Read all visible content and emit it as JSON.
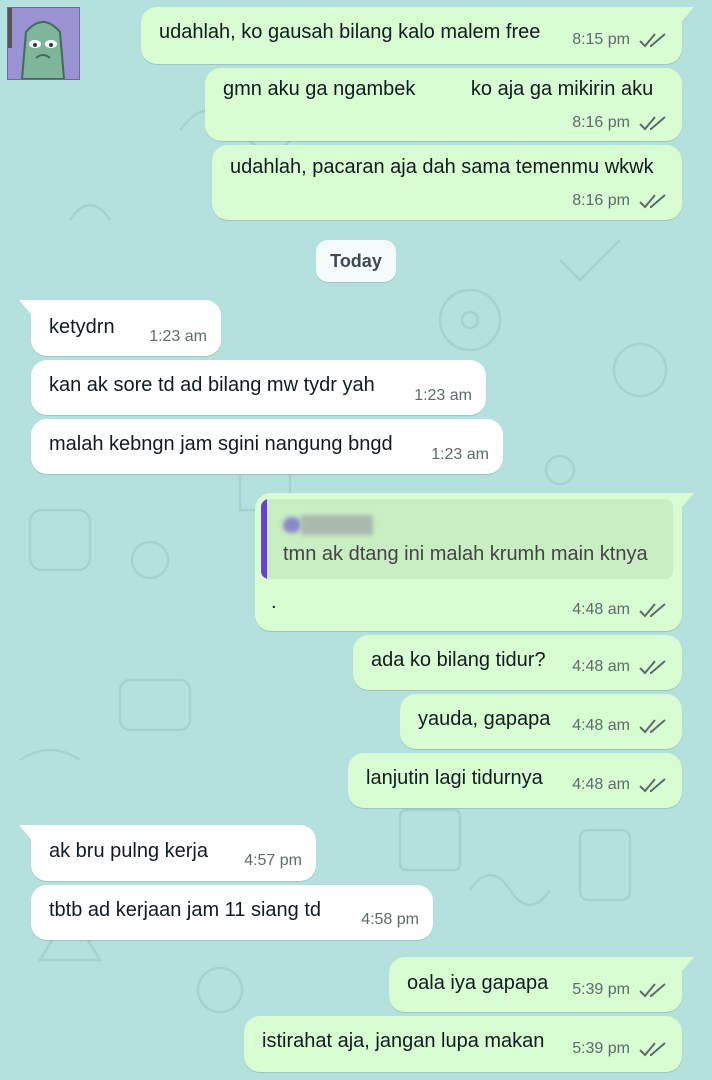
{
  "chat": {
    "date_separator": "Today",
    "messages": [
      {
        "dir": "out",
        "text": "udahlah, ko gausah bilang kalo malem free",
        "time": "8:15 pm",
        "status": "read"
      },
      {
        "dir": "out",
        "text": "gmn aku ga ngambek          ko aja ga mikirin aku",
        "time": "8:16 pm",
        "status": "read"
      },
      {
        "dir": "out",
        "text": "udahlah, pacaran aja dah sama temenmu wkwk",
        "time": "8:16 pm",
        "status": "read"
      },
      {
        "dir": "in",
        "text": "ketydrn",
        "time": "1:23 am"
      },
      {
        "dir": "in",
        "text": "kan ak sore td ad bilang mw tydr yah",
        "time": "1:23 am"
      },
      {
        "dir": "in",
        "text": "malah kebngn jam sgini nangung bngd",
        "time": "1:23 am"
      },
      {
        "dir": "out",
        "quoted_text": "tmn ak dtang ini malah krumh main ktnya",
        "text": ".",
        "time": "4:48 am",
        "status": "read"
      },
      {
        "dir": "out",
        "text": "ada ko bilang tidur?",
        "time": "4:48 am",
        "status": "read"
      },
      {
        "dir": "out",
        "text": "yauda, gapapa",
        "time": "4:48 am",
        "status": "read"
      },
      {
        "dir": "out",
        "text": "lanjutin lagi tidurnya",
        "time": "4:48 am",
        "status": "read"
      },
      {
        "dir": "in",
        "text": "ak bru pulng kerja",
        "time": "4:57 pm"
      },
      {
        "dir": "in",
        "text": "tbtb ad kerjaan jam 11 siang td",
        "time": "4:58 pm"
      },
      {
        "dir": "out",
        "text": "oala iya gapapa",
        "time": "5:39 pm",
        "status": "read"
      },
      {
        "dir": "out",
        "text": "istirahat aja, jangan lupa makan",
        "time": "5:39 pm",
        "status": "read"
      }
    ]
  },
  "colors": {
    "wallpaper": "#b4e1de",
    "outgoing_bubble": "#d8fdd2",
    "incoming_bubble": "#ffffff",
    "quote_accent": "#6b3fd0",
    "tick_color": "#5f6b6b"
  },
  "icons": {
    "read_receipt": "double-check-icon",
    "thumbnail": "sticker-thumbnail"
  }
}
